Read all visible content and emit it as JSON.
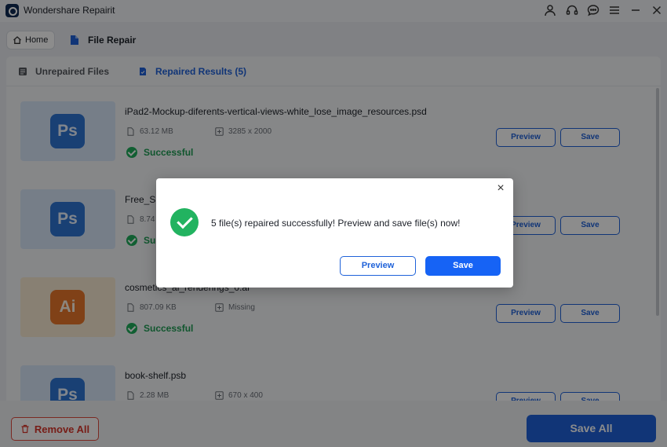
{
  "window": {
    "title": "Wondershare Repairit",
    "icons": [
      "account-icon",
      "headset-icon",
      "chat-icon",
      "menu-icon",
      "minimize-icon",
      "close-icon"
    ]
  },
  "nav": {
    "home_label": "Home",
    "section_label": "File Repair"
  },
  "tabs": {
    "unrepaired_label": "Unrepaired Files",
    "repaired_label": "Repaired Results (5)"
  },
  "files": [
    {
      "name": "iPad2-Mockup-diferents-vertical-views-white_lose_image_resources.psd",
      "type": "Ps",
      "size": "63.12 MB",
      "resolution": "3285 x 2000",
      "status": "Successful"
    },
    {
      "name": "Free_Su",
      "type": "Ps",
      "size": "8.74",
      "resolution": "",
      "status": "Su"
    },
    {
      "name": "cosmetics_ai_renderings_0.ai",
      "type": "Ai",
      "size": "807.09 KB",
      "resolution": "Missing",
      "status": "Successful"
    },
    {
      "name": "book-shelf.psb",
      "type": "Ps",
      "size": "2.28 MB",
      "resolution": "670 x 400",
      "status": ""
    }
  ],
  "row_buttons": {
    "preview": "Preview",
    "save": "Save"
  },
  "footer": {
    "remove_all": "Remove All",
    "save_all": "Save All"
  },
  "dialog": {
    "message": "5 file(s) repaired successfully! Preview and save file(s) now!",
    "preview": "Preview",
    "save": "Save",
    "close": "×"
  },
  "colors": {
    "accent": "#1f62d9",
    "success": "#1fae5b",
    "danger": "#d9362a"
  }
}
